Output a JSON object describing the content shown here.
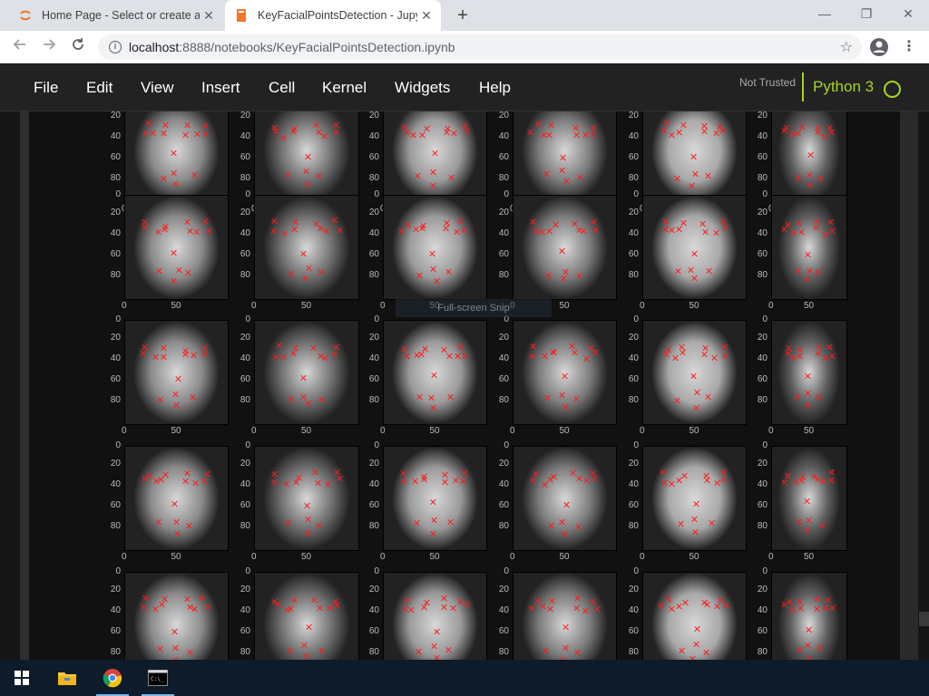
{
  "browser": {
    "tabs": [
      {
        "title": "Home Page - Select or create a n",
        "close": "✕"
      },
      {
        "title": "KeyFacialPointsDetection - Jupyte",
        "close": "✕"
      }
    ],
    "new_tab": "+",
    "window_controls": {
      "minimize": "—",
      "restore": "❐",
      "close": "✕"
    },
    "url_host": "localhost",
    "url_rest": ":8888/notebooks/KeyFacialPointsDetection.ipynb",
    "icons": {
      "back": "arrow-left-icon",
      "forward": "arrow-right-icon",
      "reload": "reload-icon",
      "info": "info-icon",
      "star": "star-icon",
      "profile": "profile-icon",
      "menu": "kebab-icon"
    }
  },
  "jupyter": {
    "menu": [
      "File",
      "Edit",
      "View",
      "Insert",
      "Cell",
      "Kernel",
      "Widgets",
      "Help"
    ],
    "trust": "Not Trusted",
    "kernel": "Python 3",
    "accent": "#a5d421"
  },
  "overlay_text": "Full-screen Snip",
  "output": {
    "y_ticks": [
      "0",
      "20",
      "40",
      "60",
      "80"
    ],
    "x_tick": "50",
    "x_zero": "0",
    "grid": {
      "rows": 5,
      "cols": 6
    }
  },
  "taskbar": {
    "items": [
      "windows-start",
      "file-explorer",
      "chrome",
      "command-prompt"
    ]
  }
}
